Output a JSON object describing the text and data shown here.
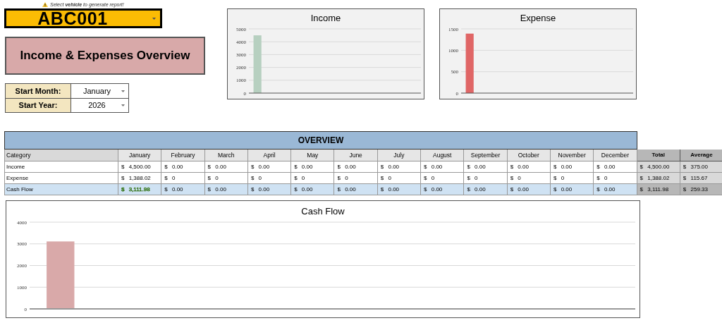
{
  "notice": {
    "text": "Select **vehicle** to generate report!"
  },
  "vehicle_select": {
    "value": "ABC001"
  },
  "title": "Income & Expenses Overview",
  "filters": [
    {
      "label": "Start Month:",
      "value": "January"
    },
    {
      "label": "Start Year:",
      "value": "2026"
    }
  ],
  "income_chart": {
    "chart_data": {
      "type": "bar",
      "title": "Income",
      "grid": true,
      "ylim": [
        0,
        5000
      ],
      "yticks": [
        0,
        1000,
        2000,
        3000,
        4000,
        5000
      ],
      "series": [
        {
          "color": "#b7d0c0",
          "values": [
            4500,
            0,
            0,
            0,
            0,
            0,
            0,
            0,
            0,
            0,
            0,
            0
          ]
        }
      ]
    }
  },
  "expense_chart": {
    "chart_data": {
      "type": "bar",
      "title": "Expense",
      "grid": true,
      "ylim": [
        0,
        1500
      ],
      "yticks": [
        0,
        500,
        1000,
        1500
      ],
      "series": [
        {
          "color": "#e06666",
          "values": [
            1390,
            0,
            0,
            0,
            0,
            0,
            0,
            0,
            0,
            0,
            0,
            0
          ]
        }
      ]
    }
  },
  "overview": {
    "title": "OVERVIEW",
    "columns": [
      {
        "label": "Category",
        "kind": "category"
      },
      {
        "label": "January",
        "kind": "month"
      },
      {
        "label": "February",
        "kind": "month"
      },
      {
        "label": "March",
        "kind": "month"
      },
      {
        "label": "April",
        "kind": "month"
      },
      {
        "label": "May",
        "kind": "month"
      },
      {
        "label": "June",
        "kind": "month"
      },
      {
        "label": "July",
        "kind": "month"
      },
      {
        "label": "August",
        "kind": "month"
      },
      {
        "label": "September",
        "kind": "month"
      },
      {
        "label": "October",
        "kind": "month"
      },
      {
        "label": "November",
        "kind": "month"
      },
      {
        "label": "December",
        "kind": "month"
      },
      {
        "label": "Total",
        "kind": "summary"
      },
      {
        "label": "Average",
        "kind": "summary"
      }
    ],
    "rows": [
      {
        "highlighted": false,
        "cells": [
          "Income",
          "$ 4,500.00",
          "$ 0.00",
          "$ 0.00",
          "$ 0.00",
          "$ 0.00",
          "$ 0.00",
          "$ 0.00",
          "$ 0.00",
          "$ 0.00",
          "$ 0.00",
          "$ 0.00",
          "$ 0.00",
          "$ 4,500.00",
          "$ 375.00"
        ]
      },
      {
        "highlighted": false,
        "cells": [
          "Expense",
          "$ 1,388.02",
          "$ 0",
          "$ 0",
          "$ 0",
          "$ 0",
          "$ 0",
          "$ 0",
          "$ 0",
          "$ 0",
          "$ 0",
          "$ 0",
          "$ 0",
          "$ 1,388.02",
          "$ 115.67"
        ]
      },
      {
        "highlighted": true,
        "cells": [
          "Cash Flow",
          {
            "text": "$ 3,111.98",
            "color": "#38761d"
          },
          "$ 0.00",
          "$ 0.00",
          "$ 0.00",
          "$ 0.00",
          "$ 0.00",
          "$ 0.00",
          "$ 0.00",
          "$ 0.00",
          "$ 0.00",
          "$ 0.00",
          "$ 0.00",
          "$ 3,111.98",
          "$ 259.33"
        ]
      }
    ]
  },
  "cash_flow_chart": {
    "chart_data": {
      "type": "bar",
      "title": "Cash Flow",
      "grid": true,
      "ylim": [
        0,
        4000
      ],
      "yticks": [
        0,
        1000,
        2000,
        3000,
        4000
      ],
      "series": [
        {
          "color": "#d9a9a9",
          "values": [
            3110,
            0,
            0,
            0,
            0,
            0,
            0,
            0,
            0,
            0,
            0,
            0
          ]
        }
      ]
    }
  }
}
